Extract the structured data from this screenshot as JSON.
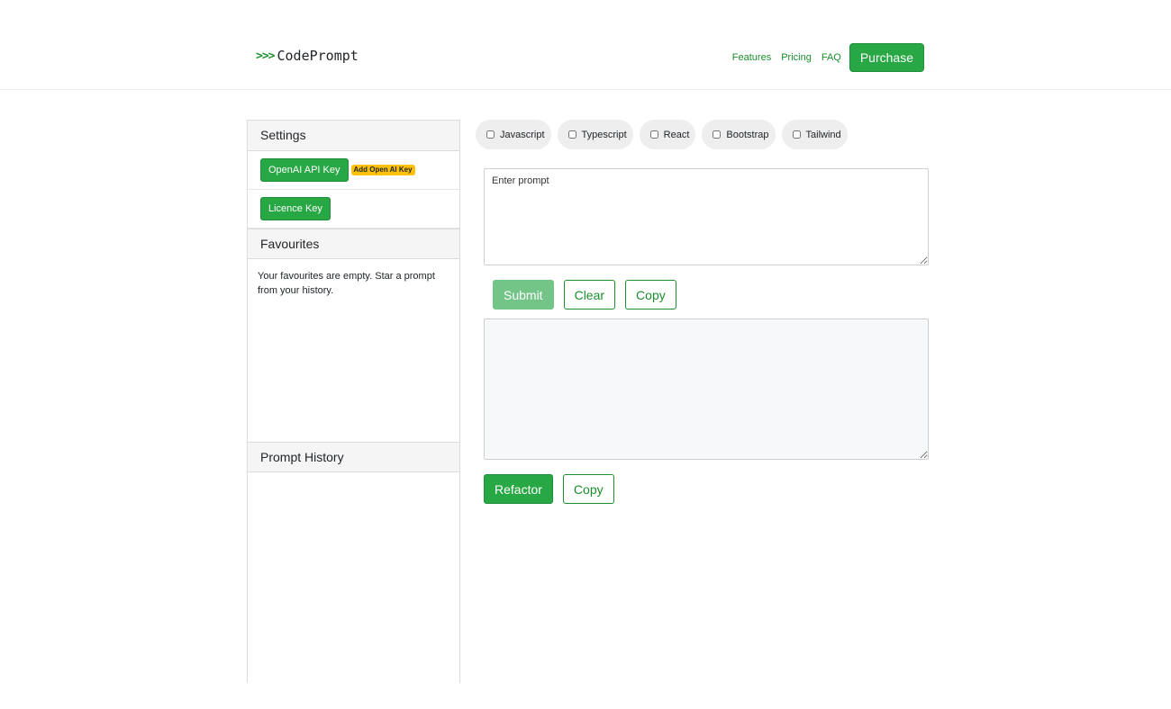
{
  "brand": {
    "arrows": ">>>",
    "name": "CodePrompt"
  },
  "nav": {
    "links": [
      "Features",
      "Pricing",
      "FAQ"
    ],
    "purchase_label": "Purchase"
  },
  "settings": {
    "title": "Settings",
    "api_key_label": "OpenAI API Key",
    "api_key_badge": "Add Open AI Key",
    "licence_key_label": "Licence Key"
  },
  "favourites": {
    "title": "Favourites",
    "empty_message": "Your favourites are empty. Star a prompt from your history."
  },
  "history": {
    "title": "Prompt History"
  },
  "tags": [
    {
      "label": "Javascript",
      "checked": false
    },
    {
      "label": "Typescript",
      "checked": false
    },
    {
      "label": "React",
      "checked": false
    },
    {
      "label": "Bootstrap",
      "checked": false
    },
    {
      "label": "Tailwind",
      "checked": false
    }
  ],
  "prompt": {
    "placeholder": "Enter prompt",
    "value": ""
  },
  "actions": {
    "submit_label": "Submit",
    "clear_label": "Clear",
    "copy_label": "Copy"
  },
  "output": {
    "value": ""
  },
  "refactor": {
    "refactor_label": "Refactor",
    "copy_label": "Copy"
  },
  "colors": {
    "accent": "#28a745",
    "link": "#198f2d",
    "badge": "#ffc107"
  }
}
